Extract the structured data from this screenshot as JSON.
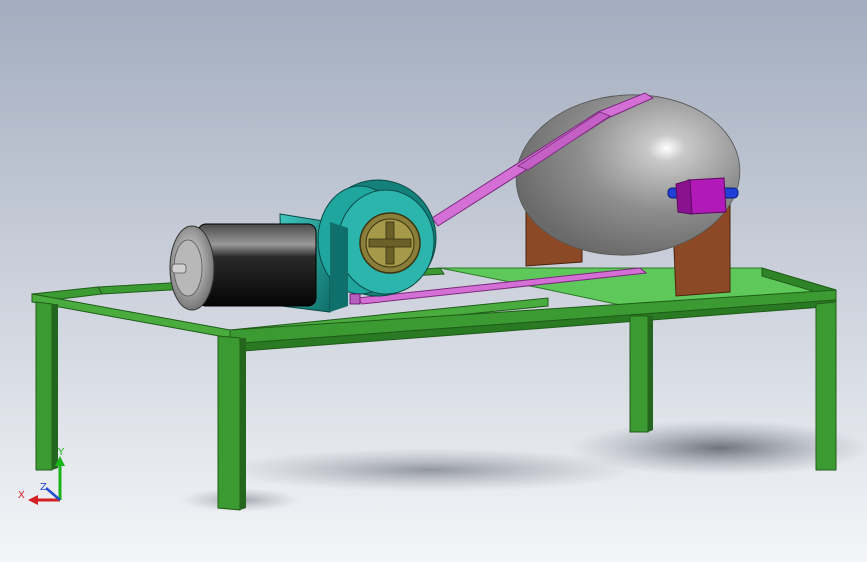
{
  "triad": {
    "x_label": "X",
    "y_label": "Y",
    "z_label": "Z"
  },
  "colors": {
    "background_top": "#a3adbf",
    "background_bottom": "#f2f3f6",
    "frame": "#3c9a32",
    "frame_dark": "#24661d",
    "platform": "#5fc85a",
    "motor_body": "#1b1b1b",
    "housing": "#1b9a94",
    "drum": "#9a9a9a",
    "pulley": "#8a7e3a",
    "belt": "#d46fd6",
    "support": "#8b4a25",
    "bearing_block": "#b21ab8",
    "shaft": "#1f3fd6",
    "axis_x": "#d42020",
    "axis_y": "#18b418",
    "axis_z": "#2050d0"
  },
  "icons": [
    "coordinate-triad-icon"
  ]
}
